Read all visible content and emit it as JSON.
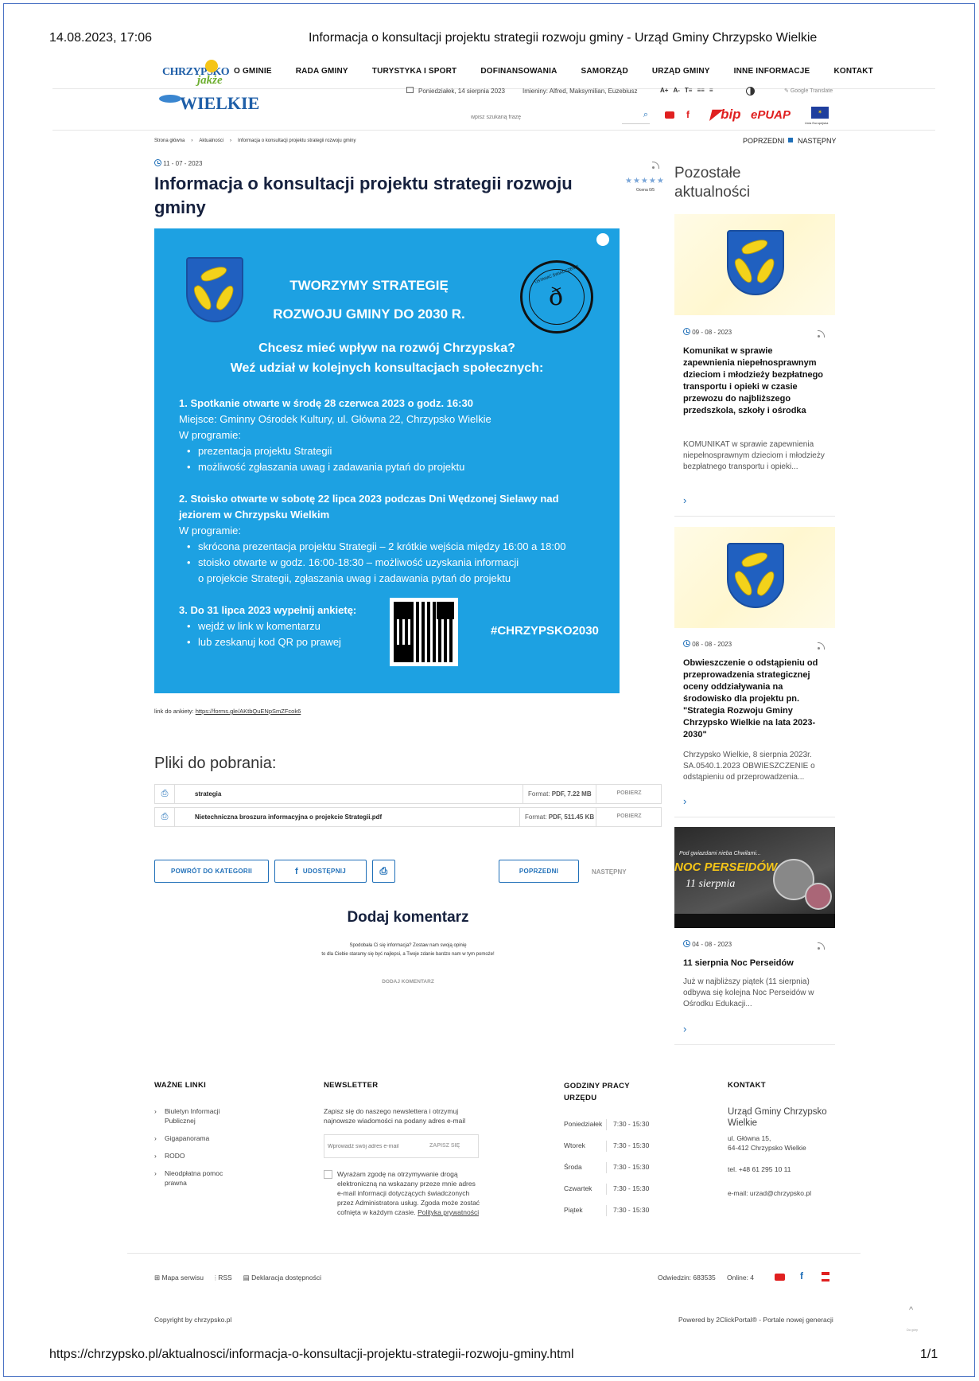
{
  "print_header": {
    "datetime": "14.08.2023, 17:06",
    "page_title": "Informacja o konsultacji projektu strategii rozwoju gminy - Urząd Gminy Chrzypsko Wielkie"
  },
  "print_footer": {
    "url": "https://chrzypsko.pl/aktualnosci/informacja-o-konsultacji-projektu-strategii-rozwoju-gminy.html",
    "page": "1/1"
  },
  "logo": {
    "line1": "CHRZYPSKO",
    "line2": "jakże",
    "line3": "WIELKIE"
  },
  "nav": [
    "O GMINIE",
    "RADA GMINY",
    "TURYSTYKA I SPORT",
    "DOFINANSOWANIA",
    "SAMORZĄD",
    "URZĄD GMINY",
    "INNE INFORMACJE",
    "KONTAKT"
  ],
  "topbar": {
    "date": "Poniedziałek, 14 sierpnia 2023",
    "nameday": "Imieniny: Alfred, Maksymilian, Euzebiusz",
    "font_controls": [
      "A+",
      "A-",
      "T≡",
      "≡≡",
      "≡"
    ],
    "translate": "Google Translate",
    "search_placeholder": "wpisz szukaną frazę",
    "bip": "bip",
    "epuap": "ePUAP",
    "eu_caption": "Unia Europejska"
  },
  "breadcrumb": [
    "Strona główna",
    "Aktualności",
    "Informacja o konsultacji projektu strategii rozwoju gminy"
  ],
  "pager_top": {
    "prev": "POPRZEDNI",
    "next": "NASTĘPNY"
  },
  "article": {
    "date": "11 - 07 - 2023",
    "title": "Informacja o konsultacji projektu strategii rozwoju gminy",
    "rating_stars": "★★★★★",
    "rating_label": "Ocena 0/5",
    "link_label": "link do ankiety:",
    "link_url": "https://forms.gle/AKtbQuENpSmZFcok6"
  },
  "poster": {
    "heading1": "TWORZYMY STRATEGIĘ",
    "heading2": "ROZWOJU GMINY DO 2030 R.",
    "stamp_text": "USTAWIĆ ŚWIADCZENIE",
    "q1": "Chcesz mieć wpływ na rozwój Chrzypska?",
    "q2": "Weź udział w kolejnych konsultacjach społecznych:",
    "s1_title": "1. Spotkanie otwarte w środę 28 czerwca 2023 o godz. 16:30",
    "s1_place": "Miejsce: Gminny Ośrodek Kultury, ul. Główna 22, Chrzypsko Wielkie",
    "s1_prog": "W programie:",
    "s1_b1": "prezentacja projektu Strategii",
    "s1_b2": "możliwość zgłaszania uwag i zadawania pytań do projektu",
    "s2_title1": "2. Stoisko otwarte w sobotę 22 lipca 2023 podczas Dni Wędzonej Sielawy nad",
    "s2_title2": "jeziorem w Chrzypsku Wielkim",
    "s2_prog": "W programie:",
    "s2_b1": "skrócona prezentacja projektu Strategii – 2 krótkie wejścia między 16:00 a 18:00",
    "s2_b2a": "stoisko otwarte w godz. 16:00-18:30 – możliwość uzyskania informacji",
    "s2_b2b": "o projekcie Strategii, zgłaszania uwag i zadawania pytań do projektu",
    "s3_title": "3. Do 31 lipca 2023 wypełnij ankietę:",
    "s3_b1": "wejdź w link w komentarzu",
    "s3_b2": "lub zeskanuj kod QR po prawej",
    "hashtag": "#CHRZYPSKO2030"
  },
  "downloads": {
    "title": "Pliki do pobrania:",
    "files": [
      {
        "name": "strategia",
        "format_label": "Format:",
        "format": "PDF, 7.22 MB",
        "action": "POBIERZ"
      },
      {
        "name": "Nietechniczna broszura informacyjna o projekcie Strategii.pdf",
        "format_label": "Format:",
        "format": "PDF, 511.45 KB",
        "action": "POBIERZ"
      }
    ]
  },
  "actions": {
    "back": "POWRÓT DO KATEGORII",
    "share": "UDOSTĘPNIJ",
    "prev": "POPRZEDNI",
    "next": "NASTĘPNY"
  },
  "comments": {
    "title": "Dodaj komentarz",
    "line1": "Spodobała Ci się informacja? Zostaw nam swoją opinię",
    "line2": "to dla Ciebie staramy się być najlepsi, a Twoje zdanie bardzo nam w tym pomoże!",
    "cta": "DODAJ KOMENTARZ"
  },
  "sidebar": {
    "title1": "Pozostałe",
    "title2": "aktualności",
    "cards": [
      {
        "date": "09 - 08 - 2023",
        "title": "Komunikat w sprawie zapewnienia niepełnosprawnym dzieciom i młodzieży bezpłatnego transportu i opieki w czasie przewozu do najbliższego przedszkola, szkoły i ośrodka",
        "excerpt": "KOMUNIKAT w sprawie zapewnienia niepełnosprawnym dzieciom i młodzieży bezpłatnego transportu i opieki...",
        "more": "›"
      },
      {
        "date": "08 - 08 - 2023",
        "title": "Obwieszczenie o odstąpieniu od przeprowadzenia strategicznej oceny oddziaływania na środowisko dla projektu pn. \"Strategia Rozwoju Gminy Chrzypsko Wielkie na lata 2023-2030\"",
        "excerpt": "Chrzypsko Wielkie, 8 sierpnia 2023r. SA.0540.1.2023 OBWIESZCZENIE o odstąpieniu od przeprowadzenia...",
        "more": "›"
      },
      {
        "date": "04 - 08 - 2023",
        "title": "11 sierpnia Noc Perseidów",
        "excerpt": "Już w najbliższy piątek (11 sierpnia) odbywa się kolejna Noc Perseidów w Ośrodku Edukacji...",
        "more": "›",
        "img_small": "Pod gwiazdami nieba Chwilami...",
        "img_big": "NOC PERSEIDÓW",
        "img_date": "11 sierpnia"
      }
    ]
  },
  "footer": {
    "links_title": "WAŻNE LINKI",
    "links": [
      "Biuletyn Informacji Publicznej",
      "Gigapanorama",
      "RODO",
      "Nieodpłatna pomoc prawna"
    ],
    "newsletter_title": "NEWSLETTER",
    "newsletter_text": "Zapisz się do naszego newslettera i otrzymuj najnowsze wiadomości na podany adres e-mail",
    "newsletter_placeholder": "Wprowadź swój adres e-mail",
    "newsletter_button": "ZAPISZ SIĘ",
    "consent": "Wyrażam zgodę na otrzymywanie drogą elektroniczną na wskazany przeze mnie adres e-mail informacji dotyczących świadczonych przez Administratora usług. Zgoda może zostać cofnięta w każdym czasie.",
    "privacy": "Polityka prywatności",
    "hours_title1": "GODZINY PRACY",
    "hours_title2": "URZĘDU",
    "hours": [
      {
        "day": "Poniedziałek",
        "time": "7:30 - 15:30"
      },
      {
        "day": "Wtorek",
        "time": "7:30 - 15:30"
      },
      {
        "day": "Środa",
        "time": "7:30 - 15:30"
      },
      {
        "day": "Czwartek",
        "time": "7:30 - 15:30"
      },
      {
        "day": "Piątek",
        "time": "7:30 - 15:30"
      }
    ],
    "contact_title": "KONTAKT",
    "contact_name": "Urząd Gminy Chrzypsko Wielkie",
    "contact_addr1": "ul. Główna 15,",
    "contact_addr2": "64-412 Chrzypsko Wielkie",
    "contact_tel": "tel. +48 61 295 10 11",
    "contact_email": "e-mail: urzad@chrzypsko.pl",
    "bottom_links": [
      "Mapa serwisu",
      "RSS",
      "Deklaracja dostępności"
    ],
    "visits": "Odwiedzin: 683535",
    "online": "Online: 4",
    "copyright": "Copyright by chrzypsko.pl",
    "powered": "Powered by 2ClickPortal® - Portale nowej generacji",
    "to_top": "^",
    "to_top_label": "Do góry"
  },
  "colors": {
    "brand_blue": "#1f6fb8",
    "poster_blue": "#1da1e2",
    "title": "#16213e"
  }
}
